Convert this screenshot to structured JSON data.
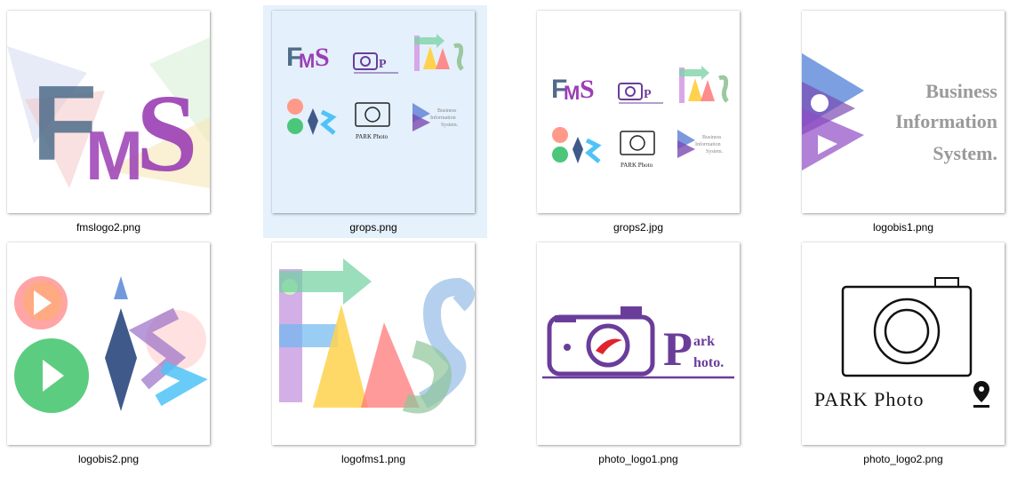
{
  "files": [
    {
      "name": "fmslogo2.png",
      "selected": false
    },
    {
      "name": "grops.png",
      "selected": true
    },
    {
      "name": "grops2.jpg",
      "selected": false
    },
    {
      "name": "logobis1.png",
      "selected": false
    },
    {
      "name": "logobis2.png",
      "selected": false
    },
    {
      "name": "logofms1.png",
      "selected": false
    },
    {
      "name": "photo_logo1.png",
      "selected": false
    },
    {
      "name": "photo_logo2.png",
      "selected": false
    }
  ],
  "thumbnails": {
    "logobis1_text": [
      "Business",
      "Information",
      "System."
    ],
    "photo_logo1_text": [
      "ark",
      "hoto."
    ],
    "photo_logo2_text": "PARK Photo",
    "grops_text": [
      "Business",
      "Information",
      "System.",
      "PARK Photo"
    ],
    "fms_letters": [
      "F",
      "M",
      "S"
    ]
  },
  "colors": {
    "selection_bg": "#e5f1fb",
    "purple": "#6a3d9a",
    "fms_purple": "#9b3fb5",
    "fms_blue": "#4f6d8a"
  }
}
